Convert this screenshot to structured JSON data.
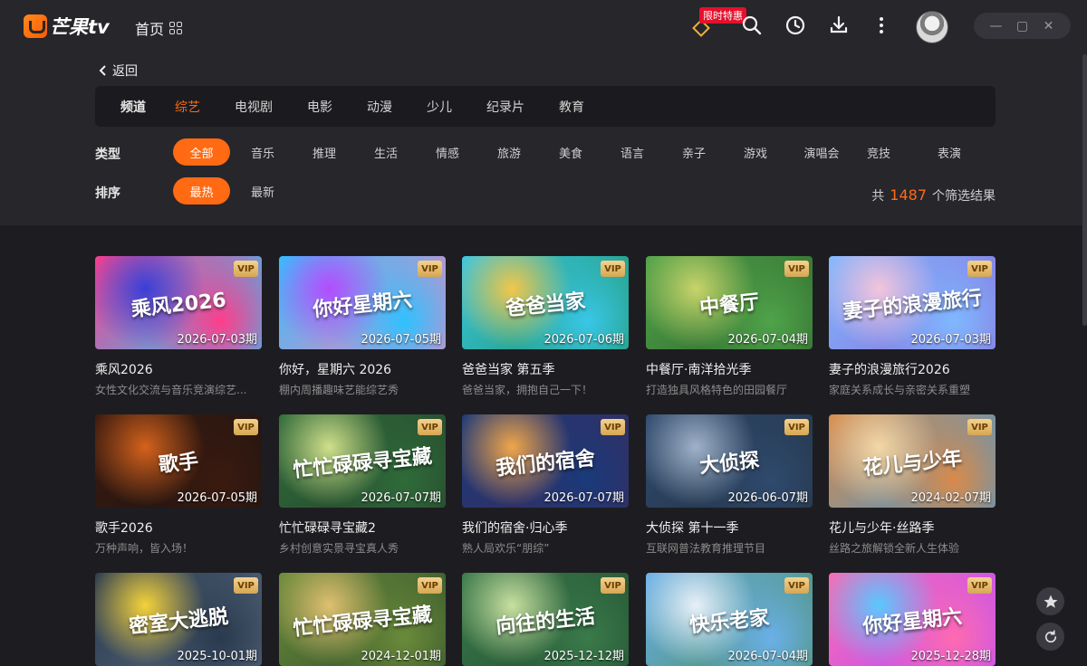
{
  "app": {
    "logo_text": "芒果",
    "logo_tv": "tv",
    "home_label": "首页"
  },
  "promo": {
    "badge": "限时特惠"
  },
  "nav": {
    "back_label": "返回"
  },
  "channels": {
    "label": "频道",
    "items": [
      "综艺",
      "电视剧",
      "电影",
      "动漫",
      "少儿",
      "纪录片",
      "教育"
    ],
    "active": "综艺"
  },
  "filters": {
    "type_label": "类型",
    "types": [
      "全部",
      "音乐",
      "推理",
      "生活",
      "情感",
      "旅游",
      "美食",
      "语言",
      "亲子",
      "游戏",
      "演唱会",
      "竞技",
      "表演"
    ],
    "sort_label": "排序",
    "sorts": [
      "最热",
      "最新"
    ]
  },
  "results": {
    "prefix": "共",
    "count": "1487",
    "suffix": "个筛选结果"
  },
  "vip_label": "VIP",
  "cards": [
    {
      "title": "乘风2026",
      "subtitle": "女性文化交流与音乐竞演综艺...",
      "date": "2026-07-03期",
      "logo": "乘风2026",
      "colors": [
        "#ff3d8b",
        "#3b3fd6",
        "#1ad0ff"
      ]
    },
    {
      "title": "你好，星期六 2026",
      "subtitle": "棚内周播趣味艺能综艺秀",
      "date": "2026-07-05期",
      "logo": "你好星期六",
      "colors": [
        "#2ec2ff",
        "#b24dff",
        "#ff7eb6"
      ]
    },
    {
      "title": "爸爸当家 第五季",
      "subtitle": "爸爸当家，拥抱自己一下！",
      "date": "2026-07-06期",
      "logo": "爸爸当家",
      "colors": [
        "#39c7e8",
        "#f2c74a",
        "#1e8f5a"
      ]
    },
    {
      "title": "中餐厅·南洋拾光季",
      "subtitle": "打造独具风格特色的田园餐厅",
      "date": "2026-07-04期",
      "logo": "中餐厅",
      "colors": [
        "#4fa34a",
        "#c8d46a",
        "#2b5f2a"
      ]
    },
    {
      "title": "妻子的浪漫旅行2026",
      "subtitle": "家庭关系成长与亲密关系重塑",
      "date": "2026-07-03期",
      "logo": "妻子的浪漫旅行",
      "colors": [
        "#7fb8ff",
        "#f3c5dc",
        "#8a6ad8"
      ]
    },
    {
      "title": "歌手2026",
      "subtitle": "万种声响，皆入场！",
      "date": "2026-07-05期",
      "logo": "歌手",
      "colors": [
        "#3b1a0f",
        "#d4621c",
        "#1a1412"
      ]
    },
    {
      "title": "忙忙碌碌寻宝藏2",
      "subtitle": "乡村创意实景寻宝真人秀",
      "date": "2026-07-07期",
      "logo": "忙忙碌碌寻宝藏",
      "colors": [
        "#2f6b3a",
        "#cfe08a",
        "#24412a"
      ]
    },
    {
      "title": "我们的宿舍·归心季",
      "subtitle": "熟人局欢乐“朋综”",
      "date": "2026-07-07期",
      "logo": "我们的宿舍",
      "colors": [
        "#1a3a7a",
        "#f0a64a",
        "#3e2a5a"
      ]
    },
    {
      "title": "大侦探 第十一季",
      "subtitle": "互联网普法教育推理节目",
      "date": "2026-06-07期",
      "logo": "大侦探",
      "colors": [
        "#2f4a6e",
        "#9fb2c9",
        "#22303f"
      ]
    },
    {
      "title": "花儿与少年·丝路季",
      "subtitle": "丝路之旅解锁全新人生体验",
      "date": "2024-02-07期",
      "logo": "花儿与少年",
      "colors": [
        "#d98a4a",
        "#f4d7a6",
        "#3d98d6"
      ]
    },
    {
      "title": "",
      "subtitle": "",
      "date": "2025-10-01期",
      "logo": "密室大逃脱",
      "colors": [
        "#2a3a4e",
        "#f4d23a",
        "#5a6a80"
      ]
    },
    {
      "title": "",
      "subtitle": "",
      "date": "2024-12-01期",
      "logo": "忙忙碌碌寻宝藏",
      "colors": [
        "#6a8a3a",
        "#e0c070",
        "#2a4a2a"
      ]
    },
    {
      "title": "",
      "subtitle": "",
      "date": "2025-12-12期",
      "logo": "向往的生活",
      "colors": [
        "#3a7a4a",
        "#c8e0a0",
        "#1f4a2e"
      ]
    },
    {
      "title": "",
      "subtitle": "",
      "date": "2026-07-04期",
      "logo": "快乐老家",
      "colors": [
        "#6ab0e8",
        "#e8f0f8",
        "#4a8a5a"
      ]
    },
    {
      "title": "",
      "subtitle": "",
      "date": "2025-12-28期",
      "logo": "你好星期六",
      "colors": [
        "#ff6ab0",
        "#5ac8ff",
        "#b04dff"
      ]
    }
  ]
}
